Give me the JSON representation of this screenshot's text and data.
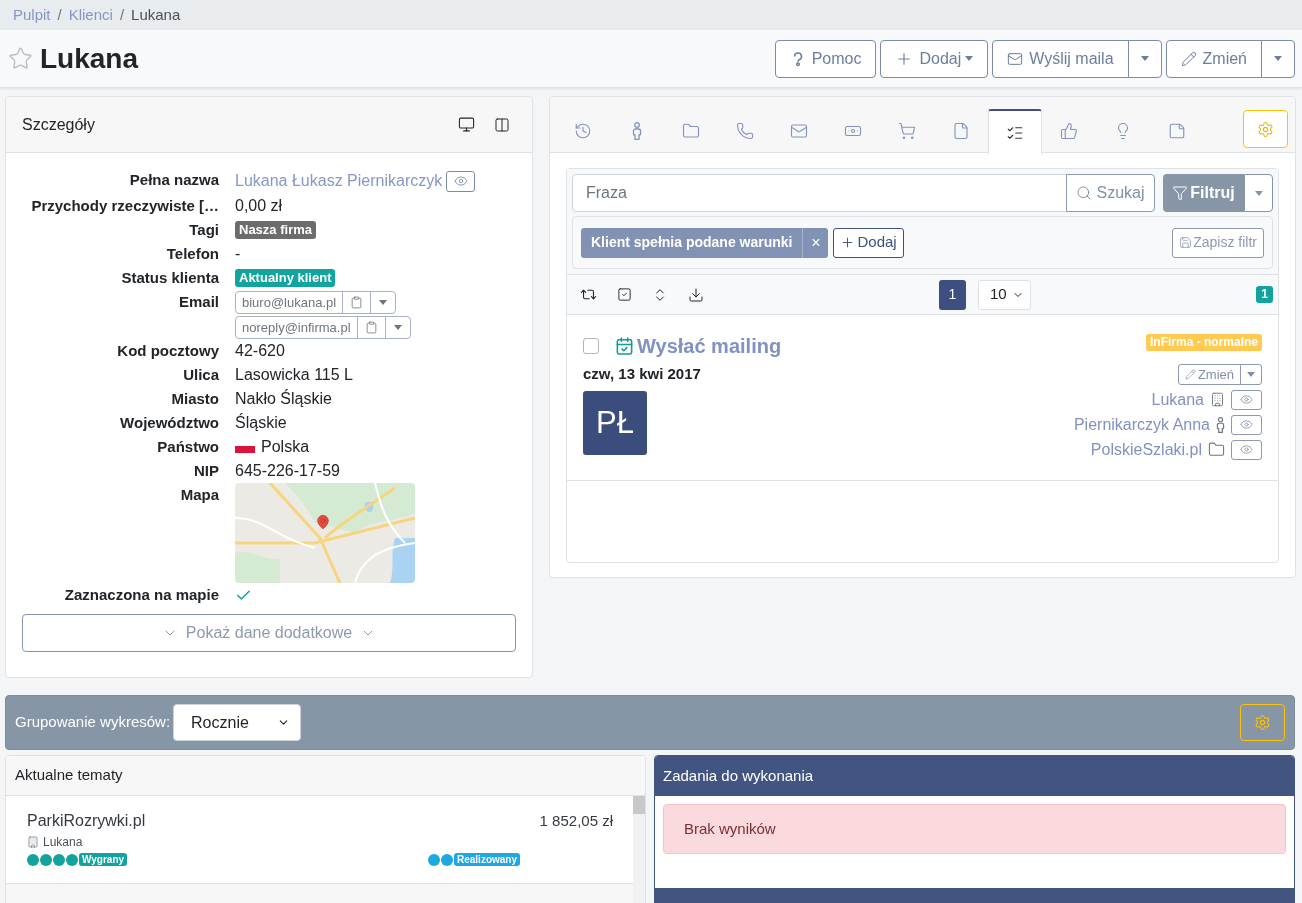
{
  "breadcrumb": [
    {
      "kind": "link",
      "label": "Pulpit"
    },
    {
      "kind": "separator",
      "label": "/"
    },
    {
      "kind": "link",
      "label": "Klienci"
    },
    {
      "kind": "separator",
      "label": "/"
    },
    {
      "kind": "current",
      "label": "Lukana"
    }
  ],
  "header": {
    "title": "Lukana",
    "favorite": false,
    "buttons": [
      {
        "label": "Pomoc",
        "kind": "plain"
      },
      {
        "label": "Dodaj",
        "kind": "dropdown"
      },
      {
        "label": "Wyślij maila",
        "kind": "split"
      },
      {
        "label": "Zmień",
        "kind": "split"
      }
    ]
  },
  "details": {
    "title": "Szczegóły",
    "fields": [
      {
        "label": "Pełna nazwa",
        "kind": "link",
        "value": "Lukana Łukasz Piernikarczyk"
      },
      {
        "label": "Przychody rzeczywiste […",
        "kind": "text",
        "value": "0,00 zł"
      },
      {
        "label": "Tagi",
        "kind": "badge",
        "value": "Nasza firma",
        "color": "#6c6c6c"
      },
      {
        "label": "Telefon",
        "kind": "text",
        "value": "-"
      },
      {
        "label": "Status klienta",
        "kind": "badge",
        "value": "Aktualny klient",
        "color": "#12a5a0"
      },
      {
        "label": "Email",
        "kind": "emails",
        "values": [
          "biuro@lukana.pl",
          "noreply@infirma.pl"
        ]
      },
      {
        "label": "Kod pocztowy",
        "kind": "text",
        "value": "42-620"
      },
      {
        "label": "Ulica",
        "kind": "text",
        "value": "Lasowicka 115 L"
      },
      {
        "label": "Miasto",
        "kind": "text",
        "value": "Nakło Śląskie"
      },
      {
        "label": "Województwo",
        "kind": "text",
        "value": "Śląskie"
      },
      {
        "label": "Państwo",
        "kind": "country",
        "value": "Polska"
      },
      {
        "label": "NIP",
        "kind": "text",
        "value": "645-226-17-59"
      },
      {
        "label": "Mapa",
        "kind": "map"
      },
      {
        "label": "Zaznaczona na mapie",
        "kind": "check",
        "checked": true
      }
    ],
    "more_button": "Pokaż dane dodatkowe"
  },
  "activity": {
    "tabs": [
      {
        "selected": false
      },
      {
        "selected": false
      },
      {
        "selected": false
      },
      {
        "selected": false
      },
      {
        "selected": false
      },
      {
        "selected": false
      },
      {
        "selected": false
      },
      {
        "selected": false
      },
      {
        "selected": true
      },
      {
        "selected": false
      },
      {
        "selected": false
      },
      {
        "selected": false
      }
    ],
    "search": {
      "placeholder": "Fraza",
      "search_button": "Szukaj",
      "filter_button": "Filtruj"
    },
    "filters": [
      {
        "label": "Klient spełnia podane warunki",
        "remove": "×"
      }
    ],
    "add_filter": "Dodaj",
    "save_filter": "Zapisz filtr",
    "pagination": {
      "pages": [
        {
          "label": "1",
          "selected": true
        }
      ],
      "page_size": "10",
      "count": "1"
    },
    "tasks": [
      {
        "title": "Wysłać mailing",
        "checked": false,
        "priority": "InFirma - normalne",
        "date": "czw, 13 kwi 2017",
        "avatar": "PŁ",
        "edit_button": "Zmień",
        "links": [
          {
            "label": "Lukana",
            "kind": "company"
          },
          {
            "label": "Piernikarczyk Anna",
            "kind": "person"
          },
          {
            "label": "PolskieSzlaki.pl",
            "kind": "project"
          }
        ]
      }
    ]
  },
  "charts_bar": {
    "label": "Grupowanie wykresów:",
    "grouping": "Rocznie"
  },
  "topics": {
    "title": "Aktualne tematy",
    "items": [
      {
        "name": "ParkiRozrywki.pl",
        "amount": "1 852,05 zł",
        "client": "Lukana",
        "statuses": [
          {
            "label": "Wygrany",
            "color": "#12a39e",
            "dots": [
              {
                "color": "#12a39e"
              },
              {
                "color": "#12a39e"
              },
              {
                "color": "#12a39e"
              },
              {
                "color": "#12a39e"
              }
            ]
          },
          {
            "label": "Realizowany",
            "color": "#1ea7e0",
            "dots": [
              {
                "color": "#1ea7e0"
              },
              {
                "color": "#1ea7e0"
              }
            ]
          }
        ]
      }
    ]
  },
  "tasks_panel": {
    "title": "Zadania do wykonania",
    "empty": "Brak wyników"
  }
}
